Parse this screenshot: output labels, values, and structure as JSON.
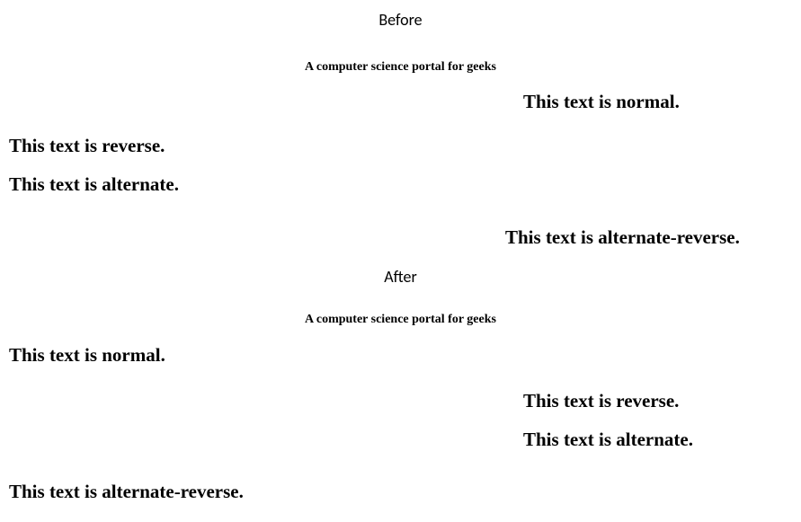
{
  "before": {
    "label": "Before",
    "subtitle": "A computer science portal for geeks",
    "lines": {
      "normal": "This text is normal.",
      "reverse": "This text is reverse.",
      "alternate": "This text is alternate.",
      "alternate_reverse": "This text is alternate-reverse."
    }
  },
  "after": {
    "label": "After",
    "subtitle": "A computer science portal for geeks",
    "lines": {
      "normal": "This text is normal.",
      "reverse": "This text is reverse.",
      "alternate": "This text is alternate.",
      "alternate_reverse": "This text is alternate-reverse."
    }
  }
}
